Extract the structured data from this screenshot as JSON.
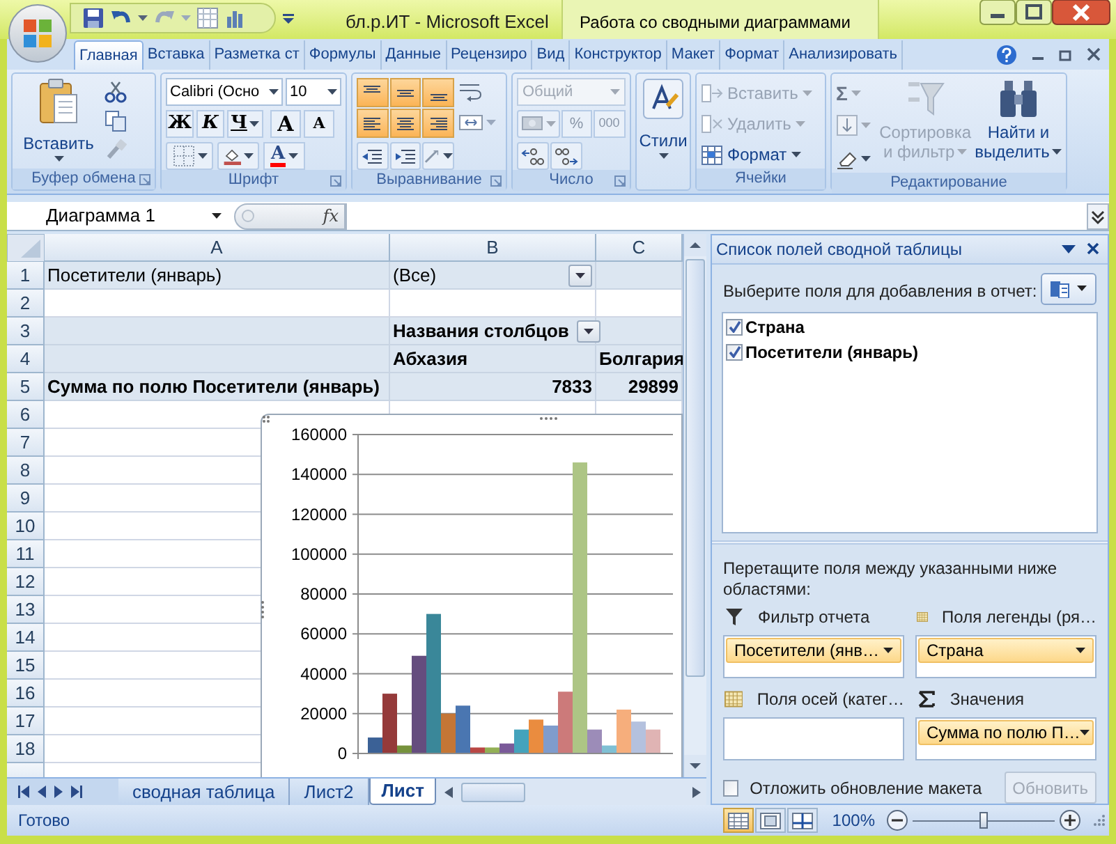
{
  "window": {
    "title": "бл.р.ИТ  -  Microsoft Excel",
    "context_title": "Работа со сводными диаграммами"
  },
  "tabs": [
    {
      "label": "Главная",
      "selected": true
    },
    {
      "label": "Вставка",
      "selected": false
    },
    {
      "label": "Разметка ст",
      "selected": false
    },
    {
      "label": "Формулы",
      "selected": false
    },
    {
      "label": "Данные",
      "selected": false
    },
    {
      "label": "Рецензиро",
      "selected": false
    },
    {
      "label": "Вид",
      "selected": false
    },
    {
      "label": "Конструктор",
      "selected": false
    },
    {
      "label": "Макет",
      "selected": false
    },
    {
      "label": "Формат",
      "selected": false
    },
    {
      "label": "Анализировать",
      "selected": false
    }
  ],
  "ribbon": {
    "groups": [
      {
        "kind": "clipboard",
        "label": "Буфер обмена",
        "paste": "Вставить"
      },
      {
        "kind": "font",
        "label": "Шрифт",
        "font_name": "Calibri (Осно",
        "font_size": "10",
        "bold": "Ж",
        "italic": "К",
        "underline": "Ч",
        "grow": "A",
        "shrink": "A",
        "font_color": "A"
      },
      {
        "kind": "alignment",
        "label": "Выравнивание",
        "buttons": [
          {
            "pressed": true
          },
          {
            "pressed": true
          },
          {
            "pressed": true
          },
          {
            "pressed": true
          },
          {
            "pressed": true
          },
          {
            "pressed": true
          }
        ]
      },
      {
        "kind": "number",
        "label": "Число",
        "format": "Общий",
        "disabled": true,
        "percent": "%",
        "thousands": "000"
      },
      {
        "kind": "styles",
        "label": "Стили"
      },
      {
        "kind": "cells",
        "label": "Ячейки",
        "items": [
          {
            "label": "Вставить",
            "disabled": true
          },
          {
            "label": "Удалить",
            "disabled": true
          },
          {
            "label": "Формат",
            "disabled": false
          }
        ]
      },
      {
        "kind": "editing",
        "label": "Редактирование",
        "sigma": "Σ",
        "sort": {
          "lines": [
            "Сортировка",
            "и фильтр"
          ],
          "disabled": true
        },
        "find": {
          "lines": [
            "Найти и",
            "выделить"
          ],
          "disabled": false
        }
      }
    ]
  },
  "formula_bar": {
    "name_box": "Диаграмма 1",
    "fx": "fx"
  },
  "sheet": {
    "columns": [
      "A",
      "B",
      "C"
    ],
    "rows": [
      {
        "number": "1",
        "band": true,
        "A": {
          "text": "Посетители (январь)",
          "kind": "filter"
        },
        "B": {
          "text": "(Все)",
          "kind": "filter",
          "dropdown": true
        }
      },
      {
        "number": "2",
        "band": false
      },
      {
        "number": "3",
        "band": true,
        "B": {
          "text": "Названия столбцов",
          "kind": "header",
          "dropdown": true
        }
      },
      {
        "number": "4",
        "band": true,
        "B": {
          "text": "Абхазия",
          "kind": "header"
        },
        "C": {
          "text": "Болгария",
          "kind": "header"
        }
      },
      {
        "number": "5",
        "band": true,
        "A": {
          "text": "Сумма по полю Посетители (январь)",
          "kind": "header"
        },
        "B": {
          "text": "7833",
          "kind": "number"
        },
        "C": {
          "text": "29899",
          "kind": "number"
        }
      },
      {
        "number": "6",
        "band": false
      },
      {
        "number": "7",
        "band": false
      },
      {
        "number": "8",
        "band": false
      },
      {
        "number": "9",
        "band": false
      },
      {
        "number": "10",
        "band": false
      },
      {
        "number": "11",
        "band": false
      },
      {
        "number": "12",
        "band": false
      },
      {
        "number": "13",
        "band": false
      },
      {
        "number": "14",
        "band": false
      },
      {
        "number": "15",
        "band": false
      },
      {
        "number": "16",
        "band": false
      },
      {
        "number": "17",
        "band": false
      },
      {
        "number": "18",
        "band": false
      }
    ]
  },
  "chart": {
    "chart_data": {
      "type": "bar",
      "grid": true,
      "ylim": [
        0,
        160000
      ],
      "yticks": [
        0,
        20000,
        40000,
        60000,
        80000,
        100000,
        120000,
        140000,
        160000
      ],
      "series": [
        {
          "color": "#3b6196",
          "values": [
            8000
          ]
        },
        {
          "color": "#953a3a",
          "values": [
            30000
          ]
        },
        {
          "color": "#76923c",
          "values": [
            4000
          ]
        },
        {
          "color": "#654d7e",
          "values": [
            49000
          ]
        },
        {
          "color": "#3a8799",
          "values": [
            70000
          ]
        },
        {
          "color": "#c47636",
          "values": [
            20000
          ]
        },
        {
          "color": "#4a76b1",
          "values": [
            24000
          ]
        },
        {
          "color": "#b94744",
          "values": [
            3000
          ]
        },
        {
          "color": "#93b055",
          "values": [
            3000
          ]
        },
        {
          "color": "#7a5a99",
          "values": [
            5000
          ]
        },
        {
          "color": "#44a3bc",
          "values": [
            12000
          ]
        },
        {
          "color": "#ea8c3f",
          "values": [
            17000
          ]
        },
        {
          "color": "#7f9ccc",
          "values": [
            14000
          ]
        },
        {
          "color": "#cc7a7a",
          "values": [
            31000
          ]
        },
        {
          "color": "#adc585",
          "values": [
            146000
          ]
        },
        {
          "color": "#9c8cb8",
          "values": [
            12000
          ]
        },
        {
          "color": "#7fc0d4",
          "values": [
            4000
          ]
        },
        {
          "color": "#f6ae7c",
          "values": [
            22000
          ]
        },
        {
          "color": "#b4c1de",
          "values": [
            16000
          ]
        },
        {
          "color": "#e0b4b4",
          "values": [
            12000
          ]
        }
      ]
    }
  },
  "sheet_tabs": [
    {
      "label": "сводная таблица",
      "selected": false
    },
    {
      "label": "Лист2",
      "selected": false
    },
    {
      "label": "Лист",
      "selected": true
    }
  ],
  "pivot_pane": {
    "title": "Список полей сводной таблицы",
    "choose_label": "Выберите поля для добавления в отчет:",
    "fields": [
      {
        "label": "Страна",
        "checked": true
      },
      {
        "label": "Посетители (январь)",
        "checked": true
      }
    ],
    "drag_label": "Перетащите поля между указанными ниже областями:",
    "areas": [
      {
        "kind": "filter",
        "label": "Фильтр отчета",
        "items": [
          "Посетители (янв…"
        ]
      },
      {
        "kind": "legend",
        "label": "Поля легенды (ря…",
        "items": [
          "Страна"
        ]
      },
      {
        "kind": "axis",
        "label": "Поля осей (катег…"
      },
      {
        "kind": "values",
        "label": "Значения",
        "items": [
          "Сумма по полю П…"
        ]
      }
    ],
    "defer": {
      "label": "Отложить обновление макета",
      "checked": false
    },
    "update_button": {
      "label": "Обновить",
      "disabled": true
    }
  },
  "status_bar": {
    "status": "Готово",
    "view_buttons": [
      {
        "selected": true
      },
      {
        "selected": false
      },
      {
        "selected": false
      }
    ],
    "zoom": {
      "text": "100%",
      "level": 0.5
    }
  }
}
